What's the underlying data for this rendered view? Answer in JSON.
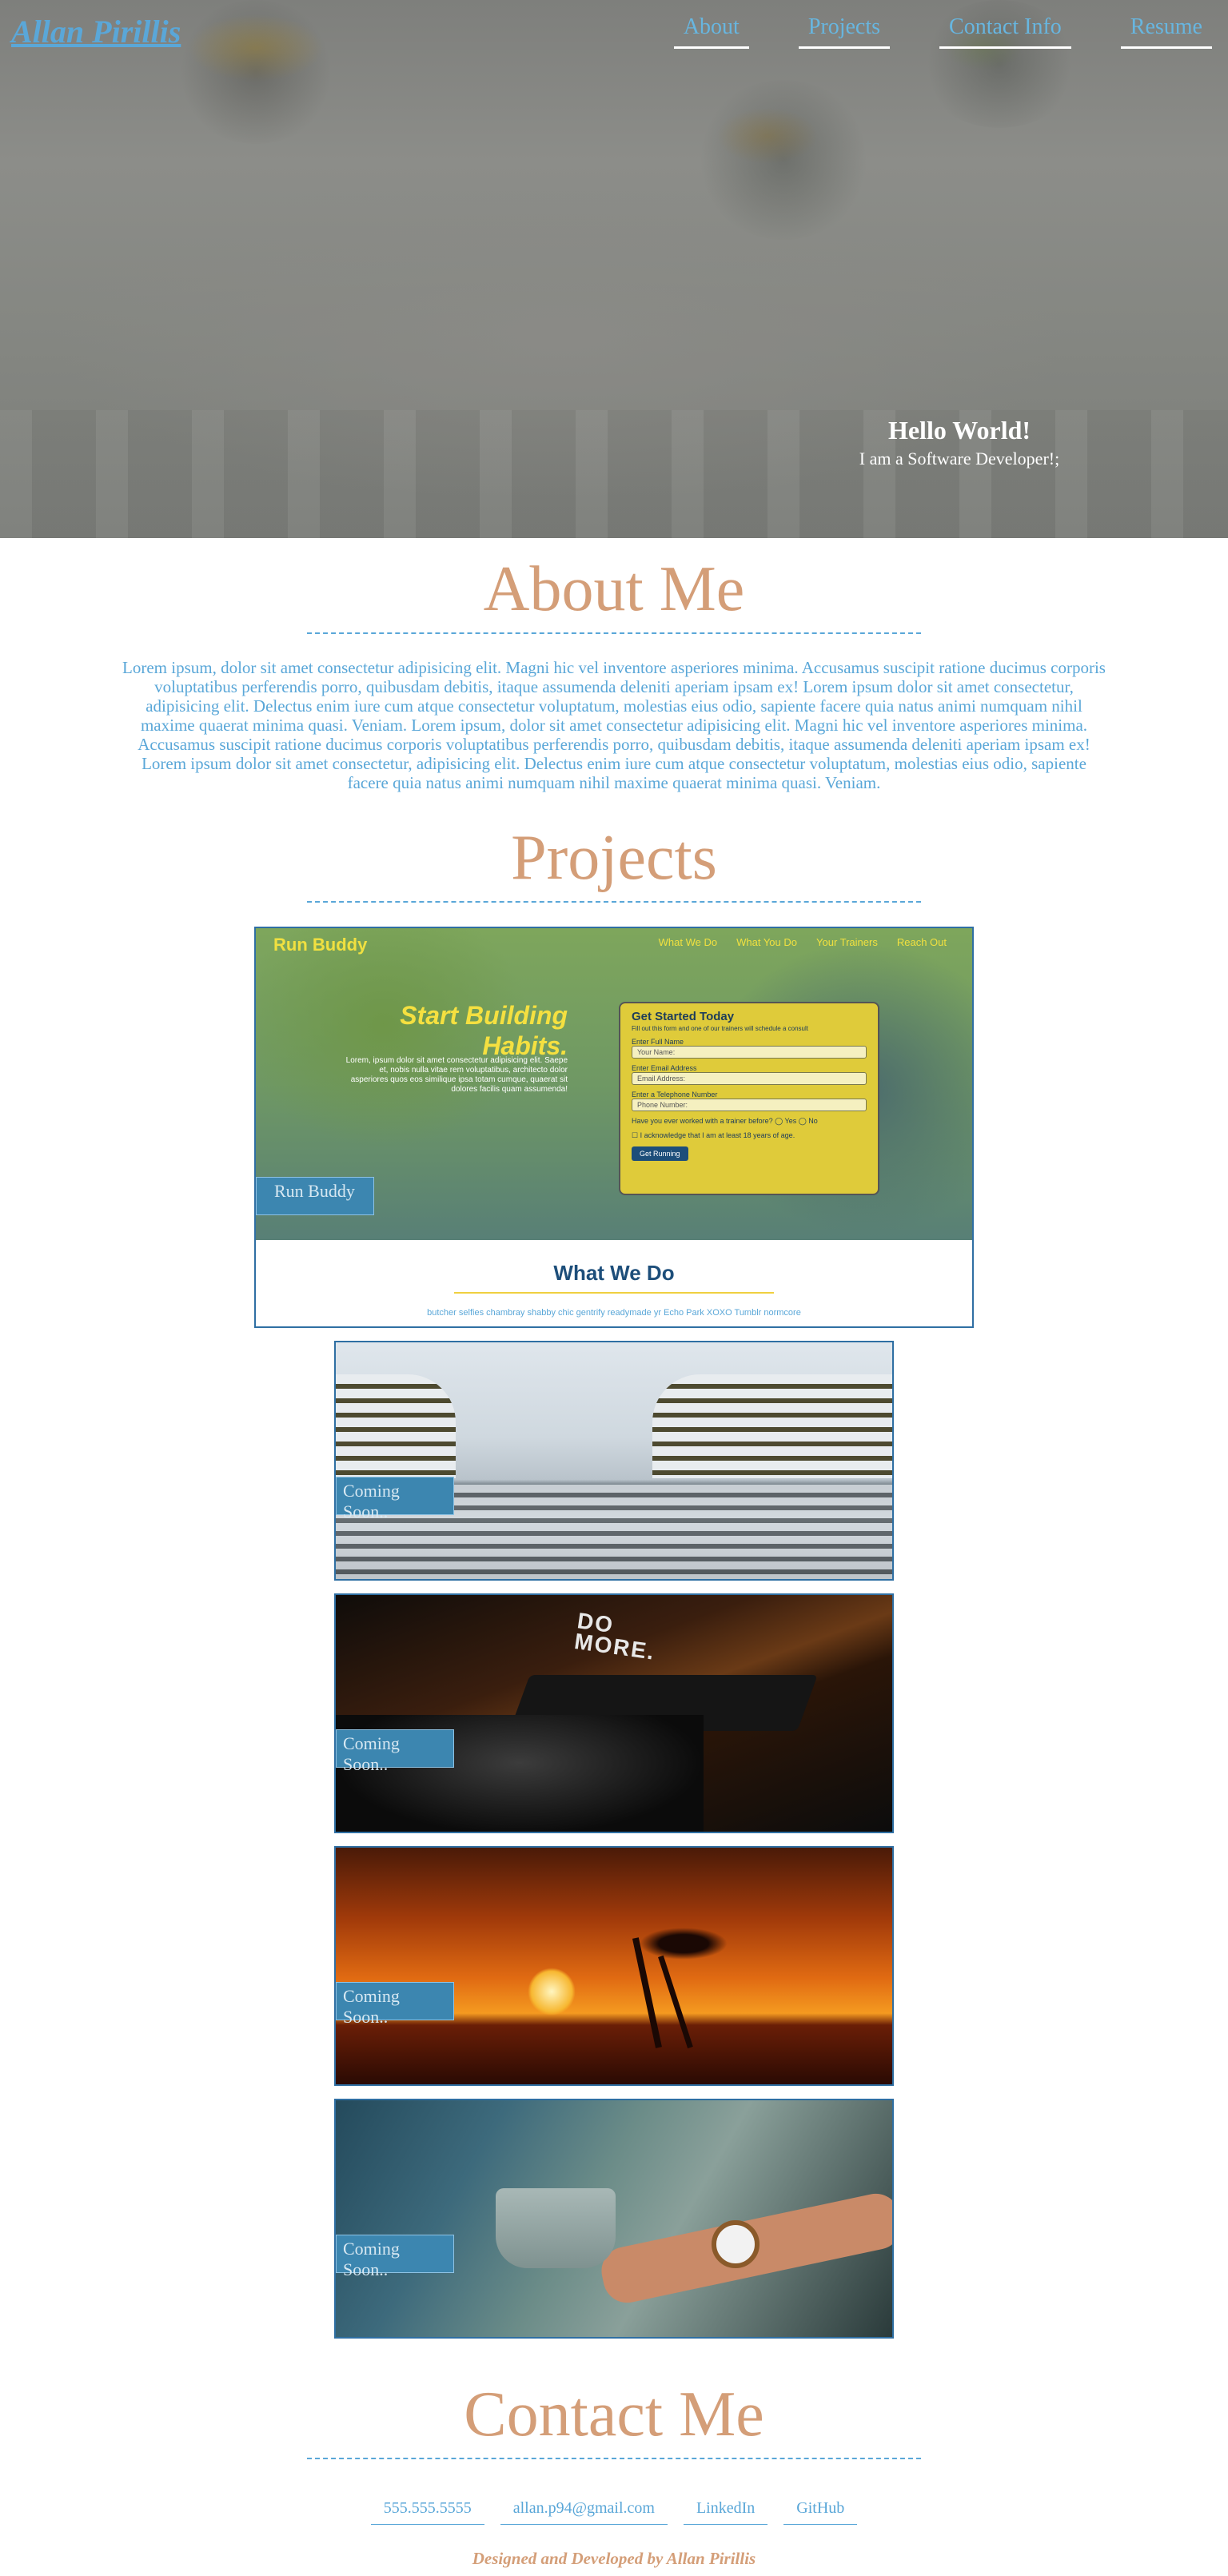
{
  "header": {
    "brand": "Allan Pirillis",
    "nav": [
      "About",
      "Projects",
      "Contact Info",
      "Resume"
    ]
  },
  "hero": {
    "greeting": "Hello World!",
    "tagline": "I am a Software Developer!;"
  },
  "about": {
    "title": "About Me",
    "body": "Lorem ipsum, dolor sit amet consectetur adipisicing elit. Magni hic vel inventore asperiores minima. Accusamus suscipit ratione ducimus corporis voluptatibus perferendis porro, quibusdam debitis, itaque assumenda deleniti aperiam ipsam ex! Lorem ipsum dolor sit amet consectetur, adipisicing elit. Delectus enim iure cum atque consectetur voluptatum, molestias eius odio, sapiente facere quia natus animi numquam nihil maxime quaerat minima quasi. Veniam. Lorem ipsum, dolor sit amet consectetur adipisicing elit. Magni hic vel inventore asperiores minima. Accusamus suscipit ratione ducimus corporis voluptatibus perferendis porro, quibusdam debitis, itaque assumenda deleniti aperiam ipsam ex! Lorem ipsum dolor sit amet consectetur, adipisicing elit. Delectus enim iure cum atque consectetur voluptatum, molestias eius odio, sapiente facere quia natus animi numquam nihil maxime quaerat minima quasi. Veniam."
  },
  "projects": {
    "title": "Projects",
    "featured": {
      "label": "Run Buddy",
      "preview": {
        "logo": "Run Buddy",
        "nav": [
          "What We Do",
          "What You Do",
          "Your Trainers",
          "Reach Out"
        ],
        "headline_1": "Start Building",
        "headline_2": "Habits.",
        "subtext": "Lorem, ipsum dolor sit amet consectetur adipisicing elit. Saepe et, nobis nulla vitae rem voluptatibus, architecto dolor asperiores quos eos similique ipsa totam cumque, quaerat sit dolores facilis quam assumenda!",
        "form_title": "Get Started Today",
        "form_intro": "Fill out this form and one of our trainers will schedule a consult",
        "field_name_label": "Enter Full Name",
        "field_name_placeholder": "Your Name:",
        "field_email_label": "Enter Email Address",
        "field_email_placeholder": "Email Address:",
        "field_phone_label": "Enter a Telephone Number",
        "field_phone_placeholder": "Phone Number:",
        "question": "Have you ever worked with a trainer before?",
        "yes": "Yes",
        "no": "No",
        "agree": "I acknowledge that I am at least 18 years of age.",
        "submit": "Get Running",
        "section_title": "What We Do",
        "section_text": "butcher selfies chambray shabby chic gentrify readymade yr Echo Park XOXO Tumblr normcore"
      }
    },
    "upcoming": [
      {
        "label": "Coming Soon.."
      },
      {
        "label": "Coming Soon.."
      },
      {
        "label": "Coming Soon.."
      },
      {
        "label": "Coming Soon.."
      }
    ]
  },
  "contact": {
    "title": "Contact Me",
    "links": [
      "555.555.5555",
      "allan.p94@gmail.com",
      "LinkedIn",
      "GitHub"
    ]
  },
  "footer": {
    "credit": "Designed and Developed by Allan Pirillis"
  },
  "colors": {
    "accent_blue": "#5aa7d8",
    "heading_tan": "#d49e78",
    "card_border": "#2f6fa3",
    "label_bg": "#3c86b0"
  }
}
